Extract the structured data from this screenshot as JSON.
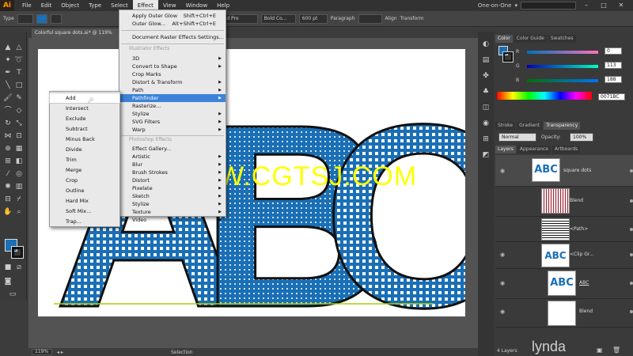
{
  "app": {
    "logo": "Ai",
    "workspace": "One-on-One"
  },
  "menubar": {
    "items": [
      "File",
      "Edit",
      "Object",
      "Type",
      "Select",
      "Effect",
      "View",
      "Window",
      "Help"
    ],
    "active": "Effect"
  },
  "control_bar": {
    "selection_type": "Type",
    "font_family": "Myriad Pro",
    "font_style": "Bold Co...",
    "font_size": "600 pt",
    "paragraph_label": "Paragraph",
    "align_label": "Align",
    "transform_label": "Transform"
  },
  "document": {
    "tab_title": "Colorful square dots.ai* @ 119%",
    "zoom": "119%",
    "status": "Selection"
  },
  "effect_menu": {
    "apply_last": {
      "label": "Apply Outer Glow",
      "shortcut": "Shift+Ctrl+E"
    },
    "last_effect": {
      "label": "Outer Glow...",
      "shortcut": "Alt+Shift+Ctrl+E"
    },
    "doc_raster": "Document Raster Effects Settings...",
    "illustrator_header": "Illustrator Effects",
    "illustrator_items": [
      "3D",
      "Convert to Shape",
      "Crop Marks",
      "Distort & Transform",
      "Path",
      "Pathfinder",
      "Rasterize...",
      "Stylize",
      "SVG Filters",
      "Warp"
    ],
    "photoshop_header": "Photoshop Effects",
    "photoshop_items": [
      "Effect Gallery...",
      "Artistic",
      "Blur",
      "Brush Strokes",
      "Distort",
      "Pixelate",
      "Sketch",
      "Stylize",
      "Texture",
      "Video"
    ],
    "highlighted": "Pathfinder"
  },
  "pathfinder_menu": {
    "items": [
      "Add",
      "Intersect",
      "Exclude",
      "Subtract",
      "Minus Back",
      "Divide",
      "Trim",
      "Merge",
      "Crop",
      "Outline",
      "Hard Mix",
      "Soft Mix...",
      "Trap..."
    ],
    "highlighted": "Add"
  },
  "color_panel": {
    "tabs": [
      "Color",
      "Color Guide",
      "Swatches"
    ],
    "channels": [
      {
        "name": "R",
        "value": "0"
      },
      {
        "name": "G",
        "value": "113"
      },
      {
        "name": "B",
        "value": "188"
      }
    ],
    "hex": "0071BC"
  },
  "transparency_panel": {
    "tabs": [
      "Stroke",
      "Gradient",
      "Transparency"
    ],
    "blend_mode": "Normal",
    "opacity_label": "Opacity:",
    "opacity": "100%"
  },
  "layers_panel": {
    "tabs": [
      "Layers",
      "Appearance",
      "Artboards"
    ],
    "rows": [
      "square dots",
      "Blend",
      "<Path>",
      "<Clip Gr...",
      "ABC",
      "Blend"
    ],
    "footer": "4 Layers"
  },
  "artwork": {
    "text": "ABC",
    "fill": "#1a6fb5"
  },
  "watermark": {
    "text": "WWW.CGTSJ.COM",
    "brand": "lynda"
  }
}
